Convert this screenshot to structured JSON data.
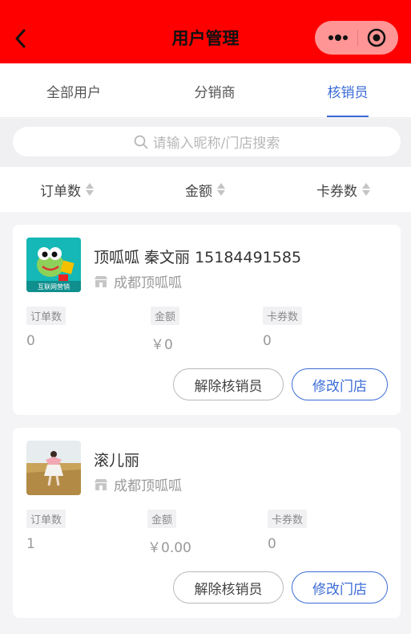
{
  "header": {
    "title": "用户管理",
    "bg_color": "#ff0000"
  },
  "tabs": [
    {
      "label": "全部用户"
    },
    {
      "label": "分销商"
    },
    {
      "label": "核销员",
      "active": true
    }
  ],
  "search": {
    "placeholder": "请输入昵称/门店搜索"
  },
  "sort": [
    {
      "label": "订单数"
    },
    {
      "label": "金额"
    },
    {
      "label": "卡券数"
    }
  ],
  "cards": [
    {
      "avatar_caption": "互联网营销",
      "name": "顶呱呱 秦文丽 15184491585",
      "store": "成都顶呱呱",
      "stats": [
        {
          "label": "订单数",
          "value": "0"
        },
        {
          "label": "金额",
          "value": "￥0"
        },
        {
          "label": "卡券数",
          "value": "0"
        }
      ],
      "btn_remove": "解除核销员",
      "btn_change": "修改门店"
    },
    {
      "name": "滚儿丽",
      "store": "成都顶呱呱",
      "stats": [
        {
          "label": "订单数",
          "value": "1"
        },
        {
          "label": "金额",
          "value": "￥0.00"
        },
        {
          "label": "卡券数",
          "value": "0"
        }
      ],
      "btn_remove": "解除核销员",
      "btn_change": "修改门店"
    }
  ],
  "colors": {
    "accent": "#3b6bd6"
  }
}
